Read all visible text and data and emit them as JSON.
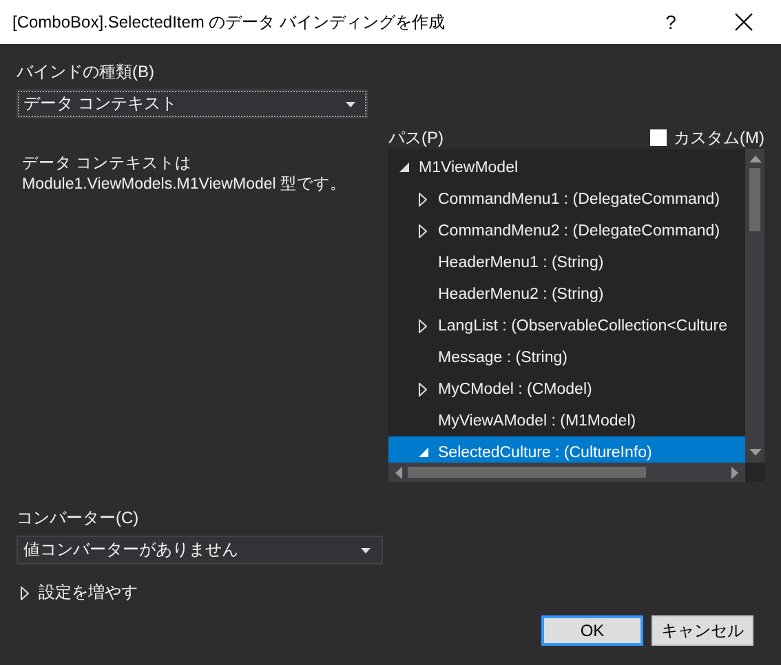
{
  "window": {
    "title": "[ComboBox].SelectedItem のデータ バインディングを作成",
    "help": "?"
  },
  "bind_type": {
    "label": "バインドの種類(B)",
    "value": "データ コンテキスト"
  },
  "description": [
    "データ コンテキストは",
    "Module1.ViewModels.M1ViewModel 型です。"
  ],
  "path": {
    "label": "パス(P)",
    "custom": {
      "label": "カスタム(M)",
      "checked": false
    },
    "tree": [
      {
        "label": "M1ViewModel",
        "kind": "group",
        "expanded": true,
        "selected": false,
        "children": [
          {
            "label": "CommandMenu1 : (DelegateCommand)",
            "kind": "group",
            "expanded": false,
            "selected": false
          },
          {
            "label": "CommandMenu2 : (DelegateCommand)",
            "kind": "group",
            "expanded": false,
            "selected": false
          },
          {
            "label": "HeaderMenu1 : (String)",
            "kind": "leaf",
            "selected": false
          },
          {
            "label": "HeaderMenu2 : (String)",
            "kind": "leaf",
            "selected": false
          },
          {
            "label": "LangList : (ObservableCollection<Culture",
            "kind": "group",
            "expanded": false,
            "selected": false
          },
          {
            "label": "Message : (String)",
            "kind": "leaf",
            "selected": false
          },
          {
            "label": "MyCModel : (CModel)",
            "kind": "group",
            "expanded": false,
            "selected": false
          },
          {
            "label": "MyViewAModel : (M1Model)",
            "kind": "leaf",
            "selected": false
          },
          {
            "label": "SelectedCulture : (CultureInfo)",
            "kind": "group",
            "expanded": true,
            "selected": true
          }
        ]
      }
    ]
  },
  "converter": {
    "label": "コンバーター(C)",
    "value": "値コンバーターがありません"
  },
  "more_settings": {
    "label": "設定を増やす",
    "expanded": false
  },
  "buttons": [
    {
      "label": "OK",
      "kind": "default"
    },
    {
      "label": "キャンセル",
      "kind": "normal"
    }
  ]
}
